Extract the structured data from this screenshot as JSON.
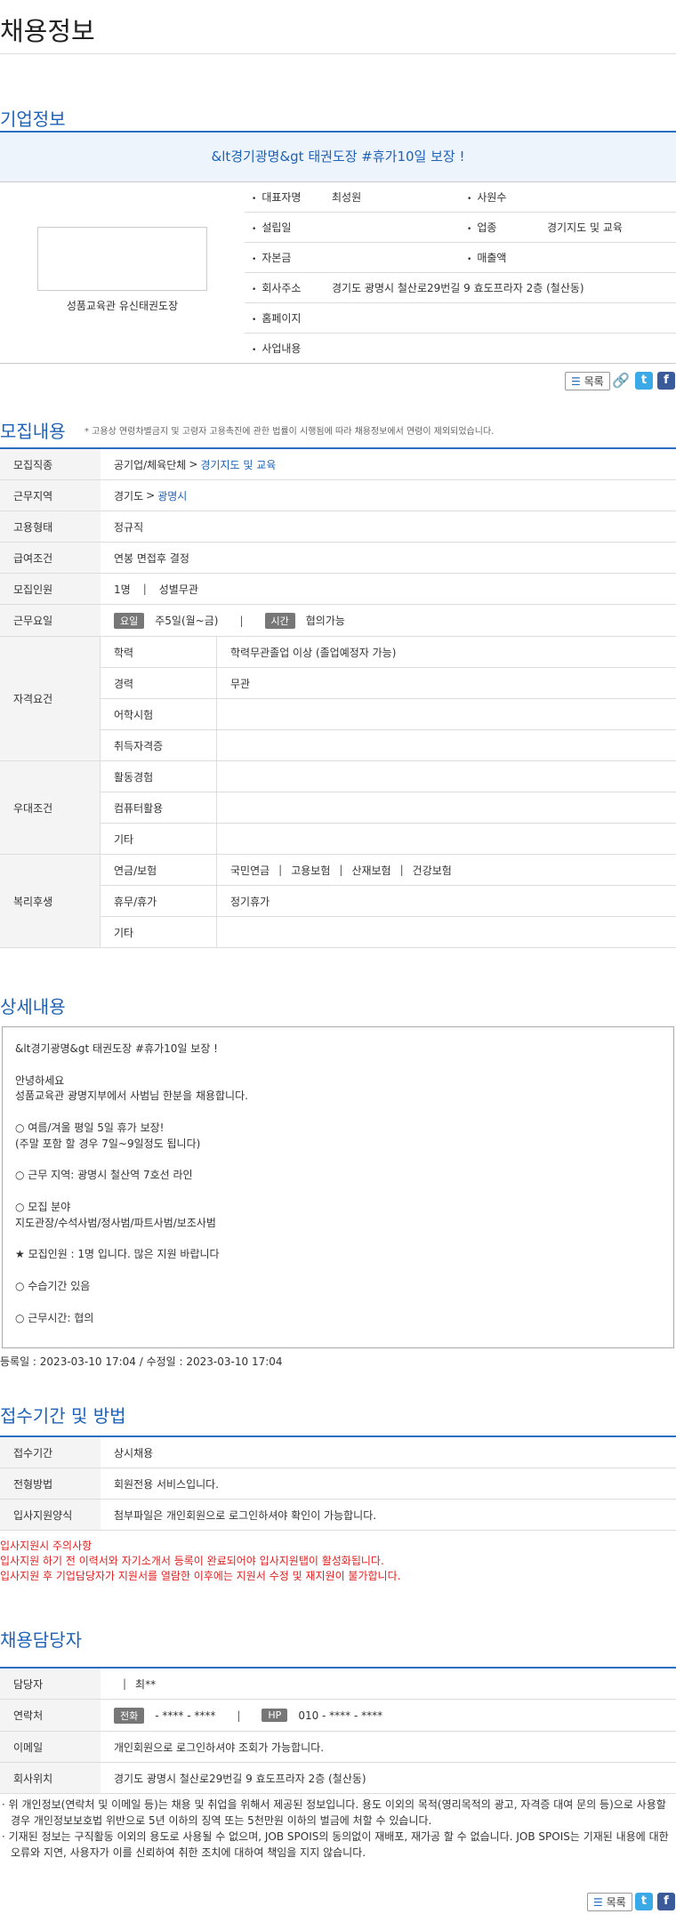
{
  "page_title": "채용정보",
  "company": {
    "section_title": "기업정보",
    "header": "&lt경기광명&gt 태권도장 #휴가10일 보장 !",
    "logo_caption": "성품교육관 유신태권도장",
    "rows": [
      [
        {
          "label": "대표자명",
          "value": "최성원"
        },
        {
          "label": "사원수",
          "value": ""
        }
      ],
      [
        {
          "label": "설립일",
          "value": ""
        },
        {
          "label": "업종",
          "value": "경기지도 및 교육"
        }
      ],
      [
        {
          "label": "자본금",
          "value": ""
        },
        {
          "label": "매출액",
          "value": ""
        }
      ],
      [
        {
          "label": "회사주소",
          "value": "경기도 광명시 철산로29번길 9 효도프라자 2층 (철산동)",
          "full": true
        }
      ],
      [
        {
          "label": "홈페이지",
          "value": "",
          "full": true
        }
      ],
      [
        {
          "label": "사업내용",
          "value": "",
          "full": true
        }
      ]
    ]
  },
  "toolbar": {
    "list_label": "목록",
    "twitter": "t",
    "facebook": "f"
  },
  "recruit": {
    "section_title": "모집내용",
    "notice": "* 고용상 연령차별금지 및 고령자 고용촉진에 관한 법률이 시행됨에 따라 채용정보에서 연령이 제외되었습니다.",
    "job_label": "모집직종",
    "job_cat": "공기업/체육단체",
    "job_sub": "경기지도 및 교육",
    "area_label": "근무지역",
    "area_main": "경기도",
    "area_sub": "광명시",
    "type_label": "고용형태",
    "type_value": "정규직",
    "pay_label": "급여조건",
    "pay_value": "연봉 면접후 결정",
    "people_label": "모집인원",
    "people_count": "1명",
    "people_gender": "성별무관",
    "days_label": "근무요일",
    "days_tag": "요일",
    "days_value": "주5일(월~금)",
    "time_tag": "시간",
    "time_value": "협의가능",
    "qual_label": "자격요건",
    "qual_rows": [
      {
        "label": "학력",
        "value": "학력무관졸업 이상 (졸업예정자 가능)"
      },
      {
        "label": "경력",
        "value": "무관"
      },
      {
        "label": "어학시험",
        "value": ""
      },
      {
        "label": "취득자격증",
        "value": ""
      }
    ],
    "pref_label": "우대조건",
    "pref_rows": [
      {
        "label": "활동경험",
        "value": ""
      },
      {
        "label": "컴퓨터활용",
        "value": ""
      },
      {
        "label": "기타",
        "value": ""
      }
    ],
    "welfare_label": "복리후생",
    "insurance_label": "연금/보험",
    "insurance": [
      "국민연금",
      "고용보험",
      "산재보험",
      "건강보험"
    ],
    "vacation_label": "휴무/휴가",
    "vacation_value": "정기휴가",
    "welfare_etc_label": "기타"
  },
  "detail": {
    "section_title": "상세내용",
    "body": "&lt경기광명&gt 태권도장 #휴가10일 보장 !\n\n안녕하세요\n성품교육관 광명지부에서 사범님 한분을 채용합니다.\n\n○ 여름/겨울 평일 5일 휴가 보장!\n(주말 포함 할 경우 7일~9일정도 됩니다)\n\n○ 근무 지역: 광명시 철산역 7호선 라인\n\n○ 모집 분야\n지도관장/수석사범/정사범/파트사범/보조사범\n\n★ 모집인원 : 1명 입니다. 많은 지원 바랍니다\n\n○ 수습기간 있음\n\n○ 근무시간: 협의",
    "dates": "등록일 : 2023-03-10 17:04 / 수정일 : 2023-03-10 17:04"
  },
  "apply": {
    "section_title": "접수기간 및 방법",
    "rows": [
      {
        "label": "접수기간",
        "value": "상시채용"
      },
      {
        "label": "전형방법",
        "value": "회원전용 서비스입니다."
      },
      {
        "label": "입사지원양식",
        "value": "첨부파일은 개인회원으로 로그인하셔야 확인이 가능합니다."
      }
    ],
    "notes": [
      "입사지원시 주의사항",
      "입사지원 하기 전 이력서와 자기소개서 등록이 완료되어야 입사지원탭이 활성화됩니다.",
      "입사지원 후 기업담당자가 지원서를 열람한 이후에는 지원서 수정 및 재지원이 불가합니다."
    ]
  },
  "contact": {
    "section_title": "채용담당자",
    "manager_label": "담당자",
    "manager_value": "최**",
    "phone_label": "연락처",
    "tel_tag": "전화",
    "tel_value": "- **** - ****",
    "hp_tag": "HP",
    "hp_value": "010 - **** - ****",
    "email_label": "이메일",
    "email_value": "개인회원으로 로그인하셔야 조회가 가능합니다.",
    "location_label": "회사위치",
    "location_value": "경기도 광명시 철산로29번길 9 효도프라자 2층 (철산동)"
  },
  "footer_notes": [
    "· 위 개인정보(연락처 및 이메일 등)는 채용 및 취업을 위해서 제공된 정보입니다. 용도 이외의 목적(영리목적의 광고, 자격증 대여 문의 등)으로 사용할 경우 개인정보보호법 위반으로 5년 이하의 징역 또는 5천만원 이하의 벌금에 처할 수 있습니다.",
    "· 기재된 정보는 구직활동 이외의 용도로 사용될 수 없으며, JOB SPOIS의 동의없이 재배포, 재가공 할 수 없습니다. JOB SPOIS는 기재된 내용에 대한 오류와 지연, 사용자가 이를 신뢰하여 취한 조치에 대하여 책임을 지지 않습니다."
  ]
}
